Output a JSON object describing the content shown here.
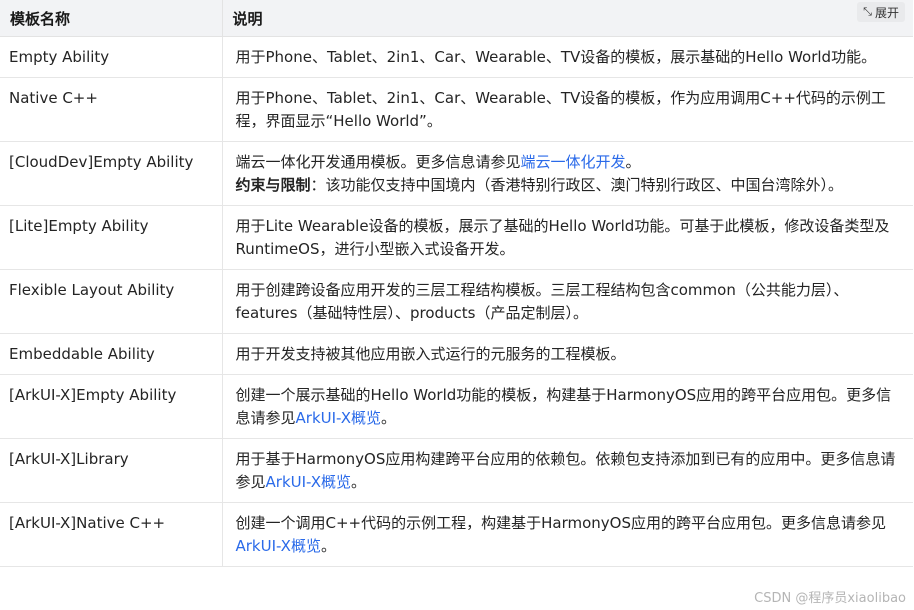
{
  "table": {
    "header": {
      "col1": "模板名称",
      "col2": "说明",
      "expand_label": "展开",
      "expand_icon": "expand-icon"
    },
    "rows": [
      {
        "name": "Empty Ability",
        "desc": "用于Phone、Tablet、2in1、Car、Wearable、TV设备的模板，展示基础的Hello World功能。"
      },
      {
        "name": "Native C++",
        "desc": "用于Phone、Tablet、2in1、Car、Wearable、TV设备的模板，作为应用调用C++代码的示例工程，界面显示“Hello World”。"
      },
      {
        "name": "[CloudDev]Empty Ability",
        "desc_pre": "端云一体化开发通用模板。更多信息请参见",
        "link": "端云一体化开发",
        "desc_post": "。",
        "constraint_label": "约束与限制",
        "constraint_text": "：该功能仅支持中国境内（香港特别行政区、澳门特别行政区、中国台湾除外）。"
      },
      {
        "name": "[Lite]Empty Ability",
        "desc": "用于Lite Wearable设备的模板，展示了基础的Hello World功能。可基于此模板，修改设备类型及RuntimeOS，进行小型嵌入式设备开发。"
      },
      {
        "name": "Flexible Layout Ability",
        "desc": "用于创建跨设备应用开发的三层工程结构模板。三层工程结构包含common（公共能力层）、features（基础特性层）、products（产品定制层）。"
      },
      {
        "name": "Embeddable Ability",
        "desc": "用于开发支持被其他应用嵌入式运行的元服务的工程模板。"
      },
      {
        "name": "[ArkUI-X]Empty Ability",
        "desc_pre": "创建一个展示基础的Hello World功能的模板，构建基于HarmonyOS应用的跨平台应用包。更多信息请参见",
        "link": "ArkUI-X概览",
        "desc_post": "。"
      },
      {
        "name": "[ArkUI-X]Library",
        "desc_pre": "用于基于HarmonyOS应用构建跨平台应用的依赖包。依赖包支持添加到已有的应用中。更多信息请参见",
        "link": "ArkUI-X概览",
        "desc_post": "。"
      },
      {
        "name": "[ArkUI-X]Native C++",
        "desc_pre": "创建一个调用C++代码的示例工程，构建基于HarmonyOS应用的跨平台应用包。更多信息请参见",
        "link": "ArkUI-X概览",
        "desc_post": "。"
      }
    ]
  },
  "watermark": "CSDN @程序员xiaolibao",
  "colors": {
    "link": "#2a6ae9",
    "header_bg": "#f2f3f5",
    "border": "#e6e6e6"
  }
}
